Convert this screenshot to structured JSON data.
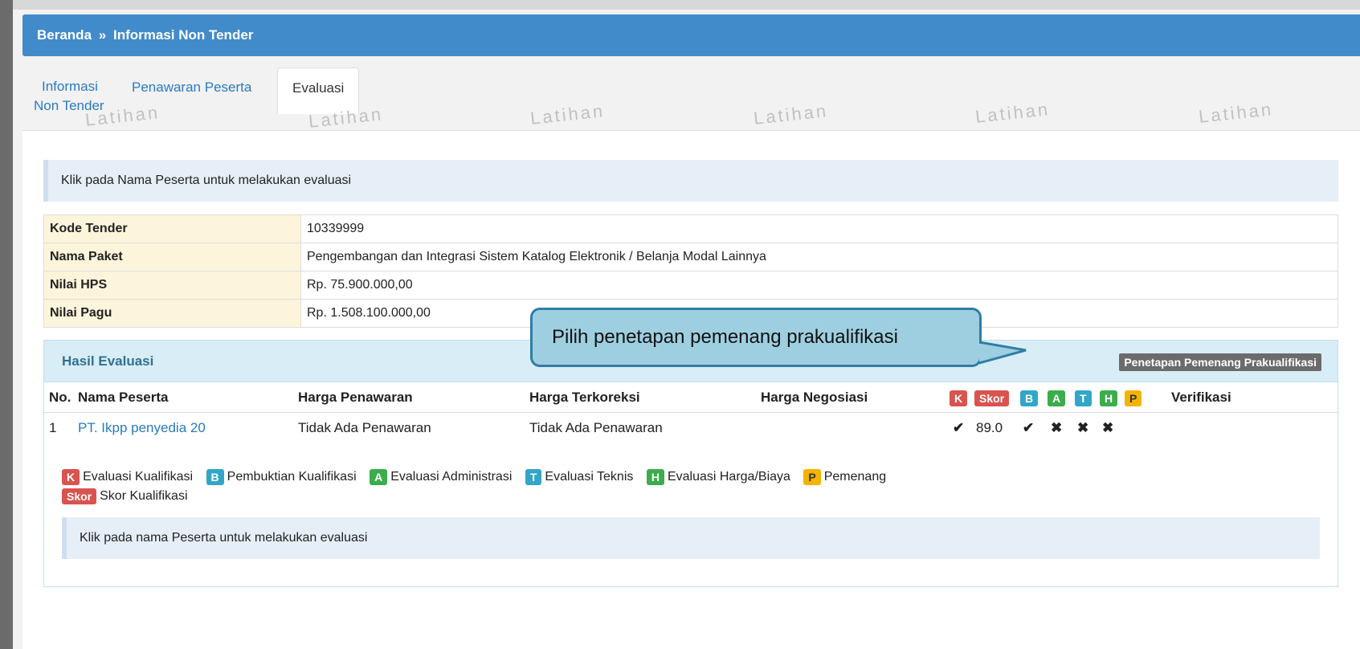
{
  "breadcrumb": {
    "home": "Beranda",
    "separator": "»",
    "current": "Informasi Non Tender"
  },
  "tabs": [
    {
      "label_line1": "Informasi",
      "label_line2": "Non Tender"
    },
    {
      "label": "Penawaran Peserta"
    },
    {
      "label": "Evaluasi"
    }
  ],
  "watermark": "Latihan",
  "alert_top": "Klik pada Nama Peserta untuk melakukan evaluasi",
  "info_table": [
    {
      "label": "Kode Tender",
      "value": "10339999"
    },
    {
      "label": "Nama Paket",
      "value": "Pengembangan dan Integrasi Sistem Katalog Elektronik / Belanja Modal Lainnya"
    },
    {
      "label": "Nilai HPS",
      "value": "Rp. 75.900.000,00"
    },
    {
      "label": "Nilai Pagu",
      "value": "Rp. 1.508.100.000,00"
    }
  ],
  "panel": {
    "title": "Hasil Evaluasi",
    "button": "Penetapan Pemenang Prakualifikasi",
    "columns": {
      "no": "No.",
      "nama": "Nama Peserta",
      "harga_penawaran": "Harga Penawaran",
      "harga_terkoreksi": "Harga Terkoreksi",
      "harga_negosiasi": "Harga Negosiasi",
      "k": "K",
      "skor": "Skor",
      "b": "B",
      "a": "A",
      "t": "T",
      "h": "H",
      "p": "P",
      "verifikasi": "Verifikasi"
    },
    "rows": [
      {
        "no": "1",
        "nama": "PT. Ikpp penyedia 20",
        "harga_penawaran": "Tidak Ada Penawaran",
        "harga_terkoreksi": "Tidak Ada Penawaran",
        "harga_negosiasi": "",
        "k": "✔",
        "skor": "89.0",
        "b": "✔",
        "a": "✖",
        "t": "✖",
        "h": "✖"
      }
    ],
    "legend": [
      {
        "badge": "K",
        "text": "Evaluasi Kualifikasi",
        "color": "#d9534f"
      },
      {
        "badge": "B",
        "text": "Pembuktian Kualifikasi",
        "color": "#31a6c8"
      },
      {
        "badge": "A",
        "text": "Evaluasi Administrasi",
        "color": "#3cad4c"
      },
      {
        "badge": "T",
        "text": "Evaluasi Teknis",
        "color": "#31a6c8"
      },
      {
        "badge": "H",
        "text": "Evaluasi Harga/Biaya",
        "color": "#3cad4c"
      },
      {
        "badge": "P",
        "text": "Pemenang",
        "color": "#f3b400"
      },
      {
        "badge": "Skor",
        "text": "Skor Kualifikasi",
        "color": "#d9534f"
      }
    ],
    "alert_bottom": "Klik pada nama Peserta untuk melakukan evaluasi"
  },
  "callout": "Pilih penetapan pemenang prakualifikasi",
  "colors": {
    "header": "#428bca",
    "panel_head": "#d9edf7",
    "label_bg": "#fcf5dc",
    "callout_bg": "#9ecfe0",
    "callout_border": "#2e7ea6"
  }
}
